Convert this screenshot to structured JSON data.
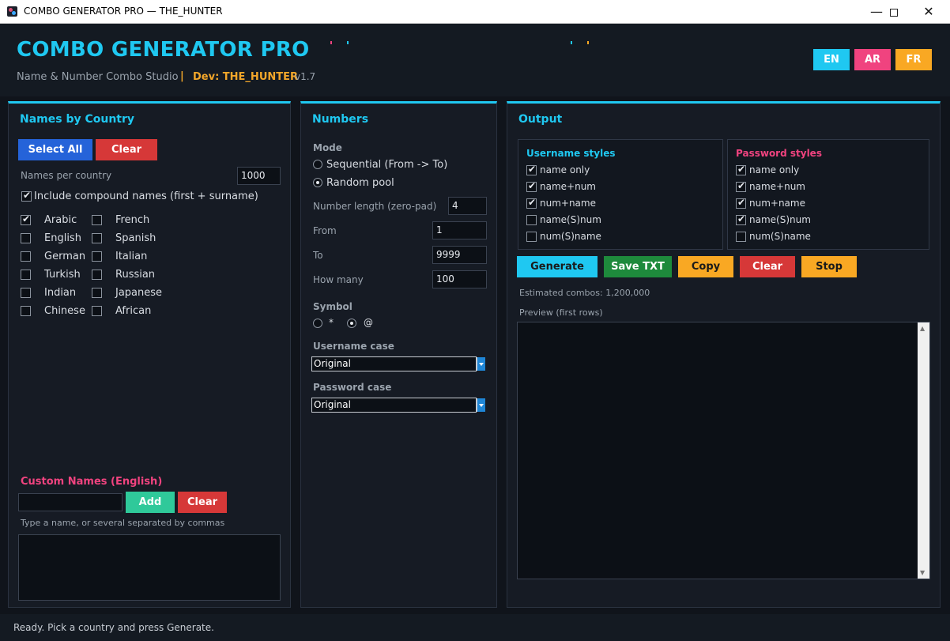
{
  "window": {
    "title": "COMBO GENERATOR PRO — THE_HUNTER",
    "minimize_icon": "minimize-icon",
    "maximize_icon": "maximize-icon",
    "close_icon": "close-icon"
  },
  "header": {
    "app_name": "COMBO GENERATOR PRO",
    "subtitle": "Name & Number Combo Studio",
    "separator": "|",
    "dev": "Dev: THE_HUNTER",
    "version": "v1.7",
    "lang_buttons": [
      {
        "label": "EN",
        "color": "#1fc8f1"
      },
      {
        "label": "AR",
        "color": "#f0437f"
      },
      {
        "label": "FR",
        "color": "#f9a823"
      }
    ]
  },
  "names_panel": {
    "title": "Names by Country",
    "select_all": "Select All",
    "clear": "Clear",
    "per_country_label": "Names per country",
    "per_country_value": "1000",
    "compound_label": "Include compound names (first + surname)",
    "compound_checked": true,
    "countries_left": [
      {
        "label": "Arabic",
        "checked": true
      },
      {
        "label": "English",
        "checked": false
      },
      {
        "label": "German",
        "checked": false
      },
      {
        "label": "Turkish",
        "checked": false
      },
      {
        "label": "Indian",
        "checked": false
      },
      {
        "label": "Chinese",
        "checked": false
      }
    ],
    "countries_right": [
      {
        "label": "French",
        "checked": false
      },
      {
        "label": "Spanish",
        "checked": false
      },
      {
        "label": "Italian",
        "checked": false
      },
      {
        "label": "Russian",
        "checked": false
      },
      {
        "label": "Japanese",
        "checked": false
      },
      {
        "label": "African",
        "checked": false
      }
    ],
    "custom_title": "Custom Names (English)",
    "custom_value": "",
    "add": "Add",
    "custom_clear": "Clear",
    "custom_hint": "Type a name, or several separated by commas"
  },
  "numbers_panel": {
    "title": "Numbers",
    "mode_label": "Mode",
    "mode_sequential": "Sequential (From -> To)",
    "mode_random": "Random pool",
    "mode_selected": "random",
    "length_label": "Number length (zero-pad)",
    "length_value": "4",
    "from_label": "From",
    "from_value": "1",
    "to_label": "To",
    "to_value": "9999",
    "howmany_label": "How many",
    "howmany_value": "100",
    "symbol_label": "Symbol",
    "symbol_star": "*",
    "symbol_at": "@",
    "symbol_selected": "@",
    "username_case_label": "Username case",
    "username_case_value": "Original",
    "password_case_label": "Password case",
    "password_case_value": "Original"
  },
  "output_panel": {
    "title": "Output",
    "username_styles_title": "Username styles",
    "username_styles": [
      {
        "label": "name only",
        "checked": true
      },
      {
        "label": "name+num",
        "checked": true
      },
      {
        "label": "num+name",
        "checked": true
      },
      {
        "label": "name(S)num",
        "checked": false
      },
      {
        "label": "num(S)name",
        "checked": false
      }
    ],
    "password_styles_title": "Password styles",
    "password_styles": [
      {
        "label": "name only",
        "checked": true
      },
      {
        "label": "name+num",
        "checked": true
      },
      {
        "label": "num+name",
        "checked": true
      },
      {
        "label": "name(S)num",
        "checked": true
      },
      {
        "label": "num(S)name",
        "checked": false
      }
    ],
    "buttons": [
      {
        "label": "Generate",
        "color": "#1fc8f1"
      },
      {
        "label": "Save TXT",
        "color": "#1e8a3c"
      },
      {
        "label": "Copy",
        "color": "#f9a823"
      },
      {
        "label": "Clear",
        "color": "#d63838"
      },
      {
        "label": "Stop",
        "color": "#f9a823"
      }
    ],
    "estimated": "Estimated combos: 1,200,000",
    "preview_label": "Preview (first rows)",
    "preview_text": ""
  },
  "status": "Ready. Pick a country and press Generate.",
  "colors": {
    "accent": "#1fc8f1",
    "pink": "#f0437f",
    "orange": "#f9a823",
    "background": "#10141b"
  }
}
